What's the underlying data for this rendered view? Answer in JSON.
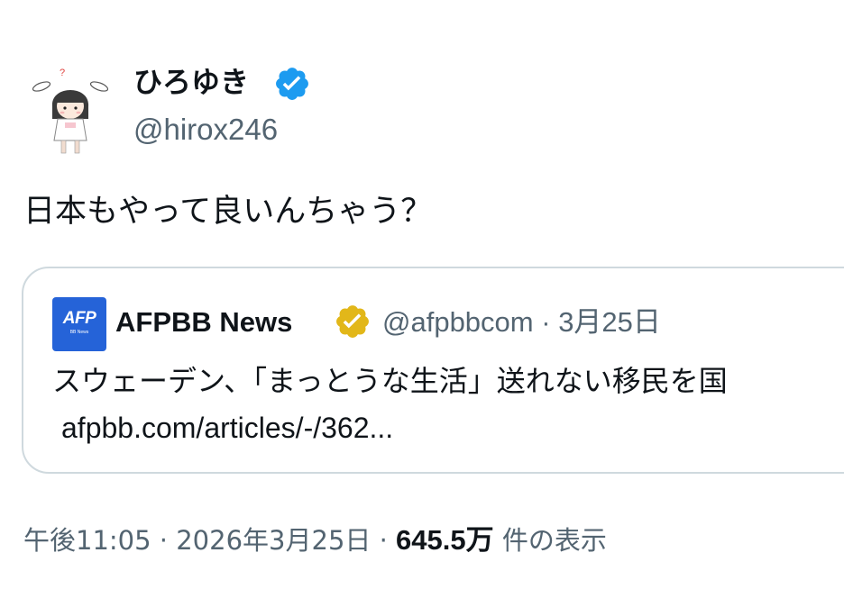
{
  "author": {
    "display_name": "ひろゆき",
    "handle": "@hirox246",
    "verified_badge": "verified-blue-icon",
    "badge_color": "#1d9bf0"
  },
  "tweet": {
    "text": "日本もやって良いんちゃう？"
  },
  "quote": {
    "logo_text": "AFP",
    "logo_subtext": "BB News",
    "display_name": "AFPBB News",
    "verified_badge": "verified-gold-icon",
    "badge_color": "#e2b719",
    "handle": "@afpbbcom",
    "separator": "·",
    "date": "3月25日",
    "text": "スウェーデン、「まっとうな生活」送れない移民を国",
    "link": "afpbb.com/articles/-/362..."
  },
  "footer": {
    "time": "午後11:05",
    "separator": "·",
    "date": "2026年3月25日",
    "views_count": "645.5万",
    "views_label": "件の表示"
  },
  "colors": {
    "text_primary": "#0f1419",
    "text_secondary": "#536471",
    "border": "#cfd9de",
    "afp_blue": "#2563d8"
  }
}
